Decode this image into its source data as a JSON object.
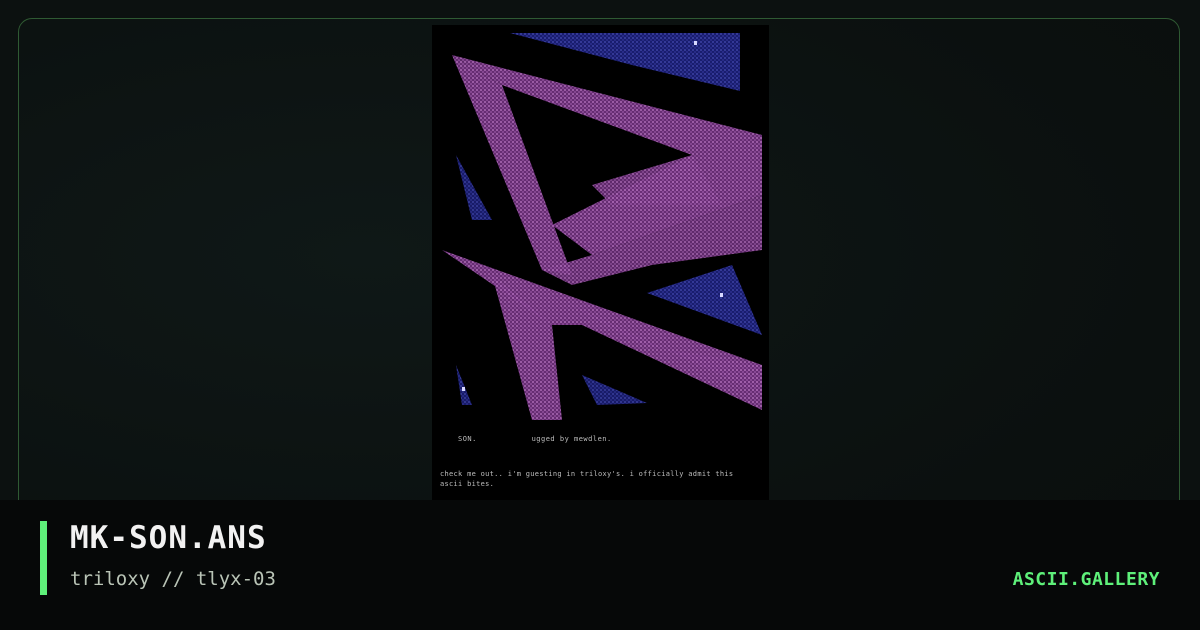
{
  "artwork": {
    "caption_left": "SON.",
    "caption_right": "ugged by mewdlen.",
    "note": "check me out.. i'm guesting in triloxy's. i officially admit this ascii bites."
  },
  "footer": {
    "title": "MK-SON.ANS",
    "subtitle": "triloxy // tlyx-03",
    "brand": "ASCII.GALLERY"
  },
  "colors": {
    "accent": "#5ef07a",
    "purple": "#7c3a86",
    "blue": "#252a8a"
  }
}
